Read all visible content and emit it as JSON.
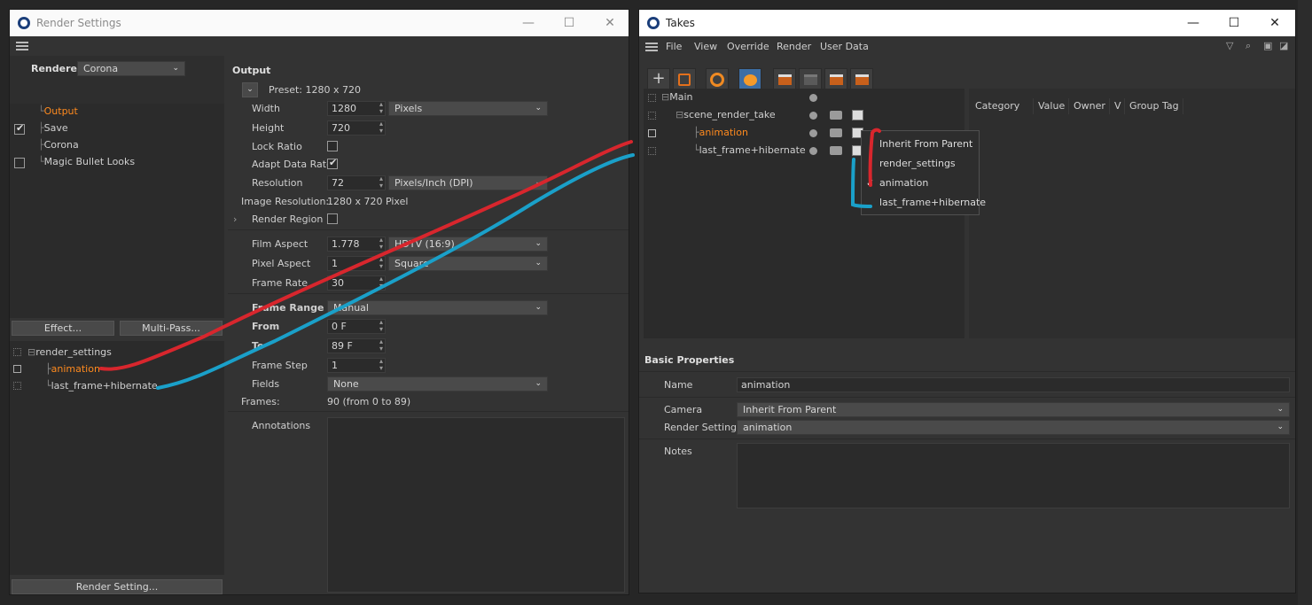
{
  "render_settings": {
    "title": "Render Settings",
    "renderer_label": "Renderer",
    "renderer_value": "Corona",
    "tree": [
      {
        "label": "Output",
        "checked": null,
        "active": true
      },
      {
        "label": "Save",
        "checked": true,
        "active": false
      },
      {
        "label": "Corona",
        "checked": null,
        "active": false
      },
      {
        "label": "Magic Bullet Looks",
        "checked": false,
        "active": false
      }
    ],
    "effect_button": "Effect...",
    "multipass_button": "Multi-Pass...",
    "settings_tree": {
      "root": "render_settings",
      "children": [
        "animation",
        "last_frame+hibernate"
      ]
    },
    "render_setting_button": "Render Setting...",
    "output": {
      "heading": "Output",
      "preset": "Preset: 1280 x 720",
      "width_label": "Width",
      "width_value": "1280",
      "width_unit": "Pixels",
      "height_label": "Height",
      "height_value": "720",
      "lock_ratio_label": "Lock Ratio",
      "adapt_frame_rate_label": "Adapt Data Rate",
      "resolution_label": "Resolution",
      "resolution_value": "72",
      "resolution_unit": "Pixels/Inch (DPI)",
      "image_resolution_label": "Image Resolution:",
      "image_resolution_value": "1280 x 720 Pixel",
      "render_region_label": "Render Region",
      "film_aspect_label": "Film Aspect",
      "film_aspect_value": "1.778",
      "film_aspect_preset": "HDTV (16:9)",
      "pixel_aspect_label": "Pixel Aspect",
      "pixel_aspect_value": "1",
      "pixel_aspect_preset": "Square",
      "frame_rate_label": "Frame Rate",
      "frame_rate_value": "30",
      "frame_range_label": "Frame Range",
      "frame_range_value": "Manual",
      "from_label": "From",
      "from_value": "0 F",
      "to_label": "To",
      "to_value": "89 F",
      "frame_step_label": "Frame Step",
      "frame_step_value": "1",
      "fields_label": "Fields",
      "fields_value": "None",
      "frames_label": "Frames:",
      "frames_value": "90 (from 0 to 89)",
      "annotations_label": "Annotations"
    }
  },
  "takes": {
    "title": "Takes",
    "menu": [
      "File",
      "View",
      "Override",
      "Render",
      "User Data"
    ],
    "tree": [
      {
        "label": "Main",
        "active": false
      },
      {
        "label": "scene_render_take",
        "active": false
      },
      {
        "label": "animation",
        "active": true
      },
      {
        "label": "last_frame+hibernate",
        "active": false
      }
    ],
    "columns": [
      "Category",
      "Value",
      "Owner",
      "V",
      "Group Tag"
    ],
    "dropdown": [
      {
        "label": "Inherit From Parent",
        "checked": false
      },
      {
        "label": "render_settings",
        "checked": false
      },
      {
        "label": "animation",
        "checked": true
      },
      {
        "label": "last_frame+hibernate",
        "checked": false
      }
    ],
    "basic_properties": {
      "heading": "Basic Properties",
      "name_label": "Name",
      "name_value": "animation",
      "camera_label": "Camera",
      "camera_value": "Inherit From Parent",
      "render_settings_label": "Render Settings",
      "render_settings_value": "animation",
      "notes_label": "Notes"
    }
  },
  "colors": {
    "active_orange": "#ff8a1e",
    "annotation_red": "#d8262d",
    "annotation_cyan": "#1aa0c9"
  }
}
